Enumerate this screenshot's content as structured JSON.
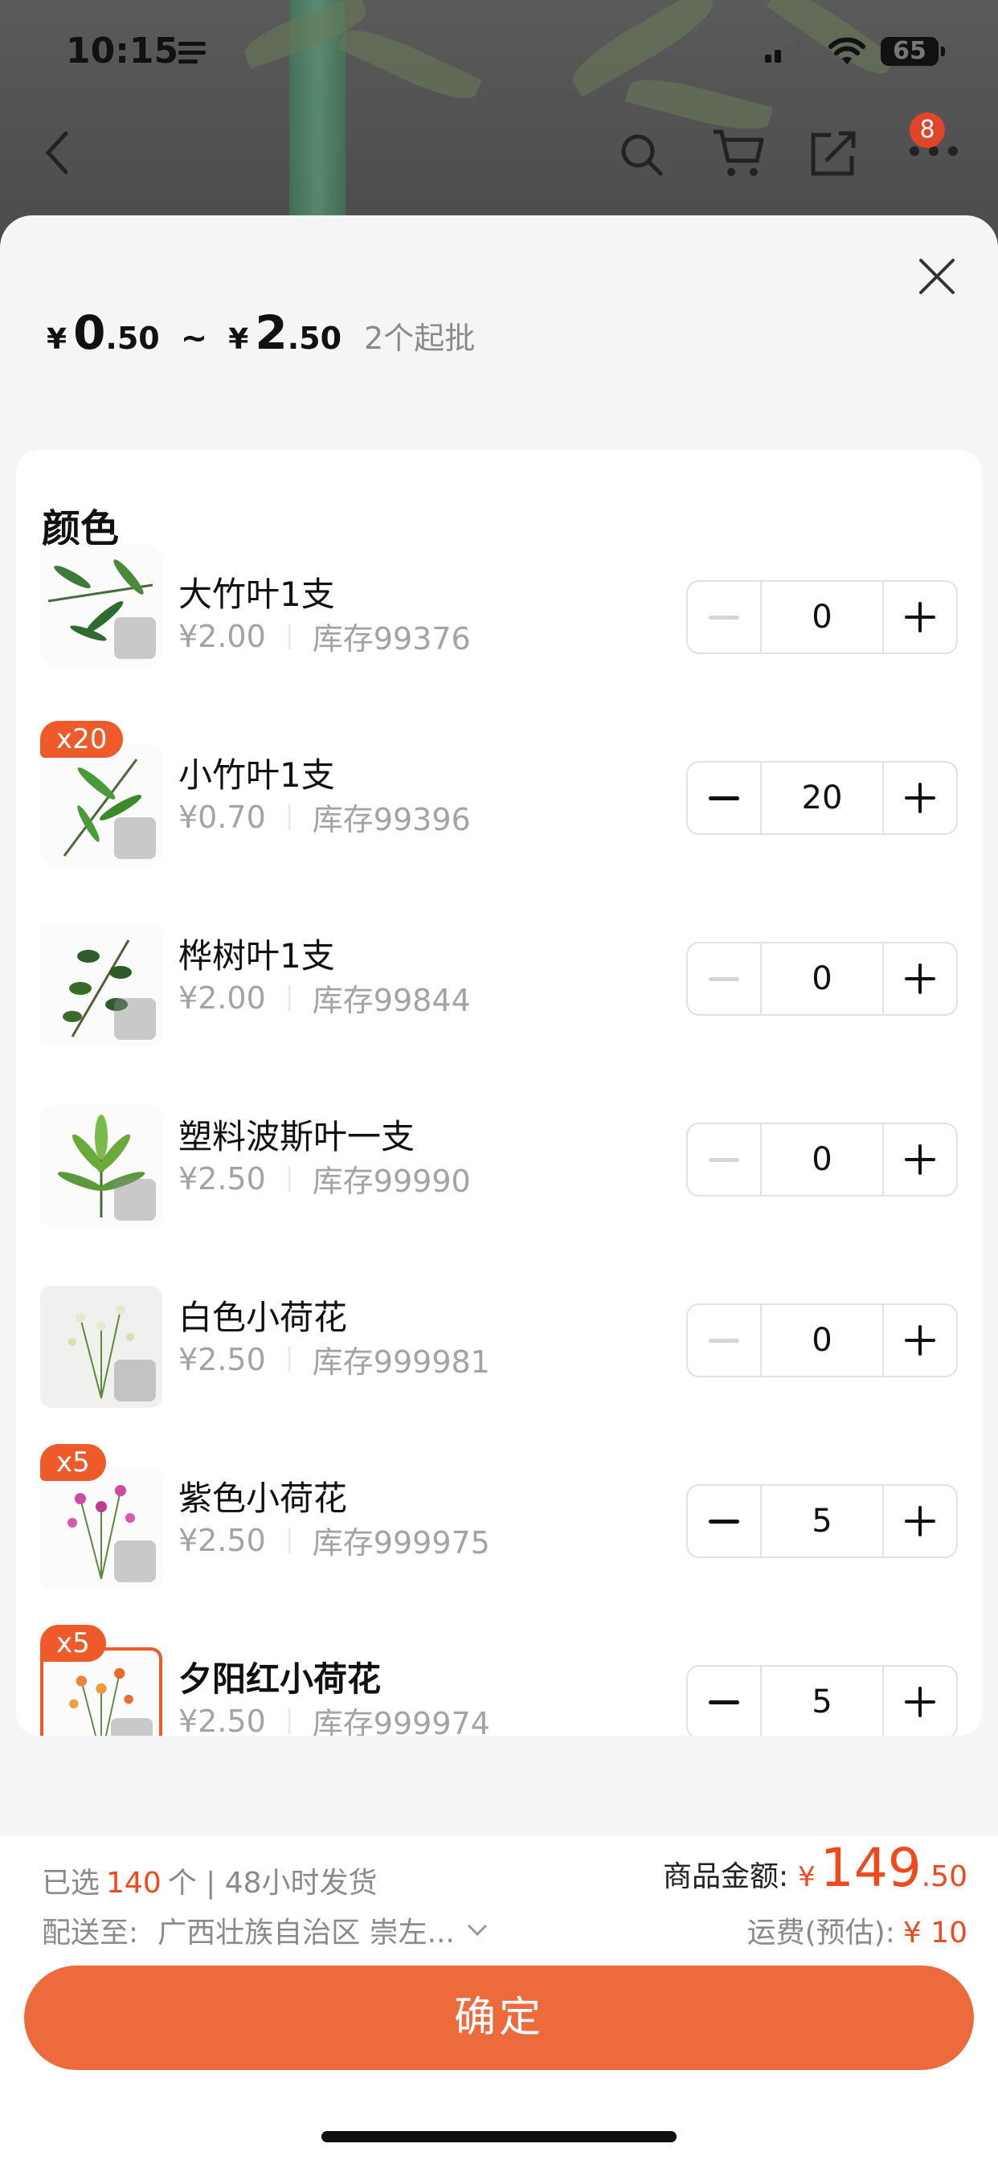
{
  "status_bar": {
    "time": "10:15",
    "battery": "65"
  },
  "nav": {
    "cart_badge": "8"
  },
  "sheet": {
    "price_min": {
      "currency": "¥",
      "int": "0",
      "dec": ".50"
    },
    "price_separator": "~",
    "price_max": {
      "currency": "¥",
      "int": "2",
      "dec": ".50"
    },
    "moq": "2个起批",
    "section_title": "颜色"
  },
  "products": [
    {
      "name": "大竹叶1支",
      "price": "¥2.00",
      "stock": "库存99376",
      "qty": "0",
      "badge": ""
    },
    {
      "name": "小竹叶1支",
      "price": "¥0.70",
      "stock": "库存99396",
      "qty": "20",
      "badge": "x20"
    },
    {
      "name": "桦树叶1支",
      "price": "¥2.00",
      "stock": "库存99844",
      "qty": "0",
      "badge": ""
    },
    {
      "name": "塑料波斯叶一支",
      "price": "¥2.50",
      "stock": "库存99990",
      "qty": "0",
      "badge": ""
    },
    {
      "name": "白色小荷花",
      "price": "¥2.50",
      "stock": "库存999981",
      "qty": "0",
      "badge": ""
    },
    {
      "name": "紫色小荷花",
      "price": "¥2.50",
      "stock": "库存999975",
      "qty": "5",
      "badge": "x5"
    },
    {
      "name": "夕阳红小荷花",
      "price": "¥2.50",
      "stock": "库存999974",
      "qty": "5",
      "badge": "x5"
    }
  ],
  "footer": {
    "selected_prefix": "已选",
    "selected_count": "140",
    "selected_suffix": "个 | 48小时发货",
    "ship_label": "配送至:",
    "ship_address": "广西壮族自治区 崇左...",
    "amount_label": "商品金额:",
    "amount_currency": "¥",
    "amount_int": "149",
    "amount_dec": ".50",
    "freight_label": "运费(预估):",
    "freight_value": "¥ 10",
    "confirm_label": "确定"
  },
  "colors": {
    "accent": "#ed6a3c",
    "price_red": "#ee4a1e"
  }
}
